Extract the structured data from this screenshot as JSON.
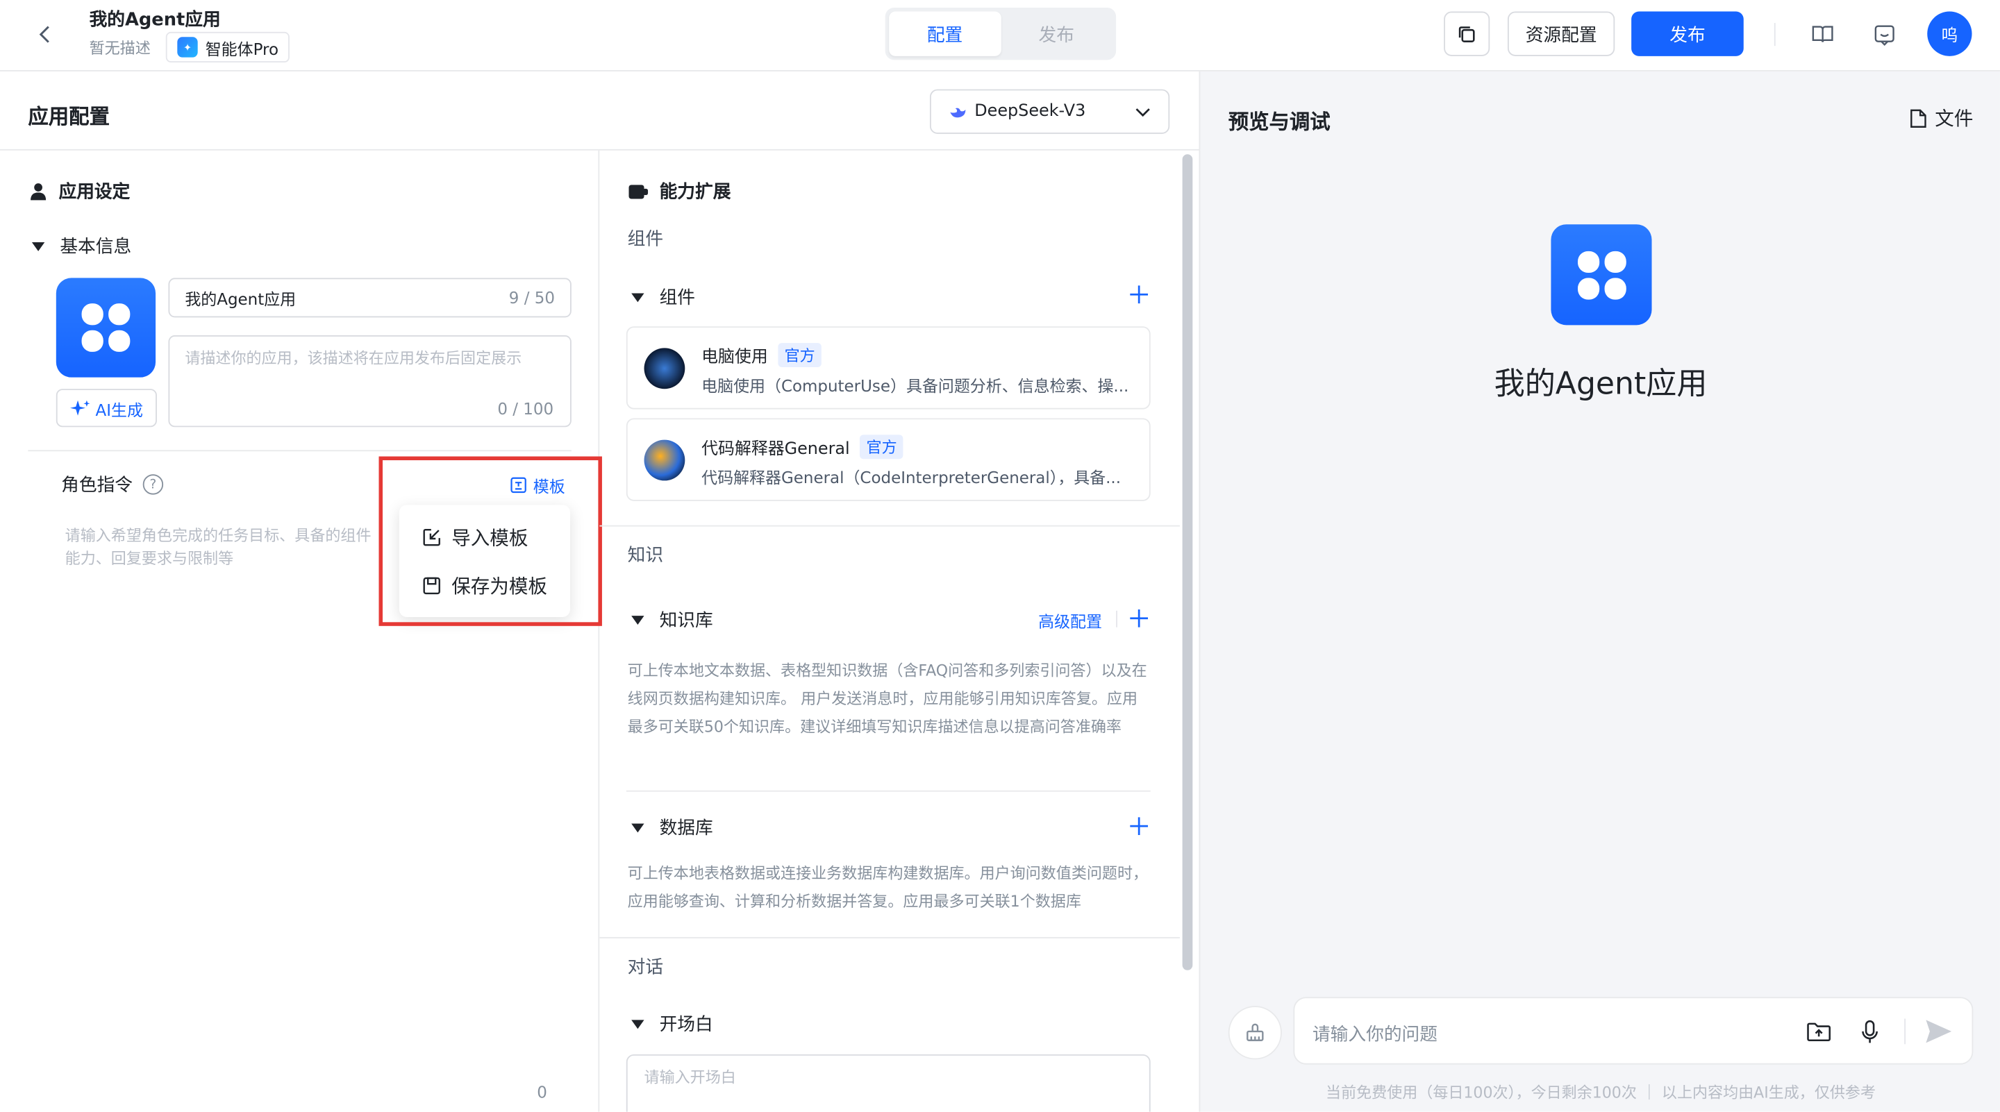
{
  "header": {
    "app_name": "我的Agent应用",
    "app_desc": "暂无描述",
    "app_type": "智能体Pro",
    "tabs": [
      {
        "label": "配置",
        "active": true
      },
      {
        "label": "发布",
        "active": false
      }
    ],
    "resource_btn": "资源配置",
    "publish_btn": "发布",
    "avatar_text": "呜",
    "accent_color": "#1664ff"
  },
  "config": {
    "title": "应用配置",
    "model": "DeepSeek-V3"
  },
  "settings": {
    "section_title": "应用设定",
    "basic_info": "基本信息",
    "name_value": "我的Agent应用",
    "name_count": "9 / 50",
    "desc_placeholder": "请描述你的应用，该描述将在应用发布后固定展示",
    "desc_count": "0 / 100",
    "ai_btn": "AI生成",
    "role_label": "角色指令",
    "template_link": "模板",
    "role_placeholder": "请输入希望角色完成的任务目标、具备的组件能力、回复要求与限制等",
    "role_count": "0",
    "template_menu": [
      "导入模板",
      "保存为模板"
    ]
  },
  "ability": {
    "section_title": "能力扩展",
    "cat_components": "组件",
    "components_header": "组件",
    "components": [
      {
        "name": "电脑使用",
        "tag": "官方",
        "desc": "电脑使用（ComputerUse）具备问题分析、信息检索、操..."
      },
      {
        "name": "代码解释器General",
        "tag": "官方",
        "desc": "代码解释器General（CodeInterpreterGeneral），具备..."
      }
    ],
    "cat_knowledge": "知识",
    "kb_header": "知识库",
    "kb_advanced": "高级配置",
    "kb_desc": "可上传本地文本数据、表格型知识数据（含FAQ问答和多列索引问答）以及在线网页数据构建知识库。 用户发送消息时，应用能够引用知识库答复。应用最多可关联50个知识库。建议详细填写知识库描述信息以提高问答准确率",
    "db_header": "数据库",
    "db_desc": "可上传本地表格数据或连接业务数据库构建数据库。用户询问数值类问题时，应用能够查询、计算和分析数据并答复。应用最多可关联1个数据库",
    "cat_dialog": "对话",
    "opening_header": "开场白",
    "opening_placeholder": "请输入开场白"
  },
  "preview": {
    "title": "预览与调试",
    "file_btn": "文件",
    "app_name": "我的Agent应用",
    "input_placeholder": "请输入你的问题",
    "footer": "当前免费使用（每日100次），今日剩余100次  ｜ 以上内容均由AI生成，仅供参考"
  }
}
